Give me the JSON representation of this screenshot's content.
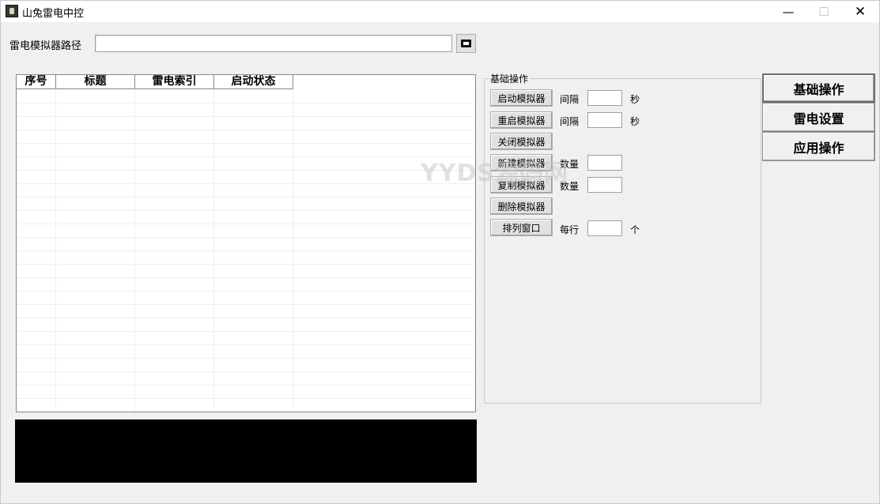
{
  "window": {
    "title": "山兔雷电中控",
    "minimize_glyph": "—",
    "maximize_glyph": "☐",
    "close_glyph": "✕"
  },
  "path_row": {
    "label": "雷电模拟器路径",
    "value": "",
    "browse_icon": "folder-open-icon"
  },
  "table": {
    "columns": [
      "序号",
      "标题",
      "雷电索引",
      "启动状态"
    ],
    "rows": []
  },
  "basic_ops": {
    "group_title": "基础操作",
    "start_button": "启动模拟器",
    "restart_button": "重启模拟器",
    "close_button": "关闭模拟器",
    "create_button": "新建模拟器",
    "copy_button": "复制模拟器",
    "delete_button": "删除模拟器",
    "arrange_button": "排列窗口",
    "interval_label": "间隔",
    "count_label": "数量",
    "per_row_label": "每行",
    "seconds_unit": "秒",
    "item_unit": "个",
    "start_interval": "",
    "restart_interval": "",
    "create_count": "",
    "copy_count": "",
    "per_row_count": ""
  },
  "side_tabs": {
    "basic": "基础操作",
    "leidian": "雷电设置",
    "app": "应用操作",
    "active": "basic"
  },
  "watermark": "YYDS源码网",
  "colors": {
    "window_bg": "#f0f0f0",
    "log_bg": "#000000",
    "button_bg": "#e1e1e1"
  }
}
